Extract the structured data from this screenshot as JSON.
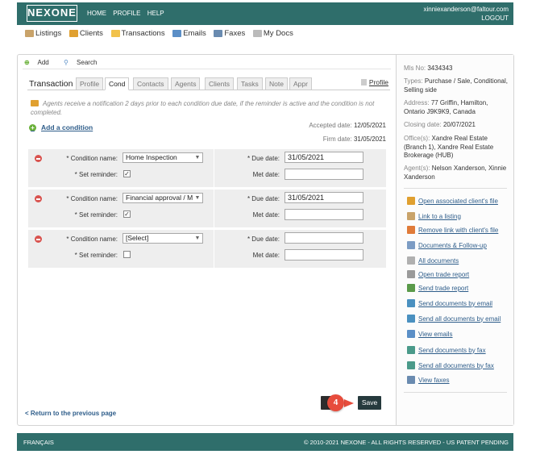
{
  "header": {
    "logo": "NEXONE",
    "nav": [
      "HOME",
      "PROFILE",
      "HELP"
    ],
    "user_email": "xinniexanderson@faltour.com",
    "logout": "LOGOUT"
  },
  "mainnav": [
    {
      "label": "Listings",
      "icon": "house-icon",
      "color": "#c9a36a"
    },
    {
      "label": "Clients",
      "icon": "people-icon",
      "color": "#e0a030"
    },
    {
      "label": "Transactions",
      "icon": "folder-icon",
      "color": "#f1c24c"
    },
    {
      "label": "Emails",
      "icon": "envelope-icon",
      "color": "#5b8fc7"
    },
    {
      "label": "Faxes",
      "icon": "fax-icon",
      "color": "#6a8bb0"
    },
    {
      "label": "My Docs",
      "icon": "documents-icon",
      "color": "#bbbbbb"
    }
  ],
  "toolbar": {
    "add": "Add",
    "search": "Search"
  },
  "tabs": {
    "title": "Transaction",
    "items": [
      "Profile",
      "Cond",
      "Contacts",
      "Agents",
      "Clients",
      "Tasks",
      "Note",
      "Appr"
    ],
    "active": "Cond",
    "profile_link": "Profile"
  },
  "notice": "Agents receive a notification 2 days prior to each condition due date, if the reminder is active and the condition is not completed.",
  "add_condition": "Add a condition",
  "dates": {
    "accepted_label": "Accepted date:",
    "accepted_value": "12/05/2021",
    "firm_label": "Firm date:",
    "firm_value": "31/05/2021"
  },
  "labels": {
    "condition_name": "* Condition name:",
    "set_reminder": "* Set reminder:",
    "due_date": "* Due date:",
    "met_date": "Met date:"
  },
  "conditions": [
    {
      "name": "Home Inspection",
      "reminder": "✓",
      "due_date": "31/05/2021",
      "met_date": ""
    },
    {
      "name": "Financial approval / M",
      "reminder": "✓",
      "due_date": "31/05/2021",
      "met_date": ""
    },
    {
      "name": "[Select]",
      "reminder": "",
      "due_date": "",
      "met_date": ""
    }
  ],
  "return_link": "< Return to the previous page",
  "save_label": "Save",
  "step_badge": "4",
  "info": {
    "mls_label": "Mls No:",
    "mls_value": "3434343",
    "types_label": "Types:",
    "types_value": "Purchase / Sale, Conditional, Selling side",
    "address_label": "Address:",
    "address_value": "77 Griffin, Hamilton, Ontario J9K9K9, Canada",
    "closing_label": "Closing date:",
    "closing_value": "20/07/2021",
    "offices_label": "Office(s):",
    "offices_value": "Xandre Real Estate (Branch 1), Xandre Real Estate Brokerage (HUB)",
    "agents_label": "Agent(s):",
    "agents_value": "Nelson Xanderson, Xinnie Xanderson"
  },
  "actions": [
    {
      "label": "Open associated client's file",
      "icon": "client-file-icon",
      "color": "#e0a030"
    },
    {
      "label": "Link to a listing",
      "icon": "house-link-icon",
      "color": "#c9a36a"
    },
    {
      "label": "Remove link with client's file",
      "icon": "remove-link-icon",
      "color": "#e07b39"
    },
    {
      "label": "Documents & Follow-up",
      "icon": "documents-icon",
      "color": "#7c9cc4"
    },
    {
      "label": "All documents",
      "icon": "all-documents-icon",
      "color": "#b0b0b0"
    },
    {
      "label": "Open trade report",
      "icon": "trade-report-icon",
      "color": "#9a9a9a"
    },
    {
      "label": "Send trade report",
      "icon": "send-report-icon",
      "color": "#5a9a4a"
    },
    {
      "label": "Send documents by email",
      "icon": "email-docs-icon",
      "color": "#4a90c0"
    },
    {
      "label": "Send all documents by email",
      "icon": "email-all-icon",
      "color": "#4a90c0"
    },
    {
      "label": "View emails",
      "icon": "view-emails-icon",
      "color": "#5b8fc7"
    },
    {
      "label": "Send documents by fax",
      "icon": "fax-docs-icon",
      "color": "#4a9a8a"
    },
    {
      "label": "Send all documents by fax",
      "icon": "fax-all-icon",
      "color": "#4a9a8a"
    },
    {
      "label": "View faxes",
      "icon": "view-faxes-icon",
      "color": "#6a8bb0"
    }
  ],
  "footer": {
    "lang": "FRANÇAIS",
    "copyright": "© 2010-2021 NEXONE - ALL RIGHTS RESERVED - US PATENT PENDING"
  }
}
